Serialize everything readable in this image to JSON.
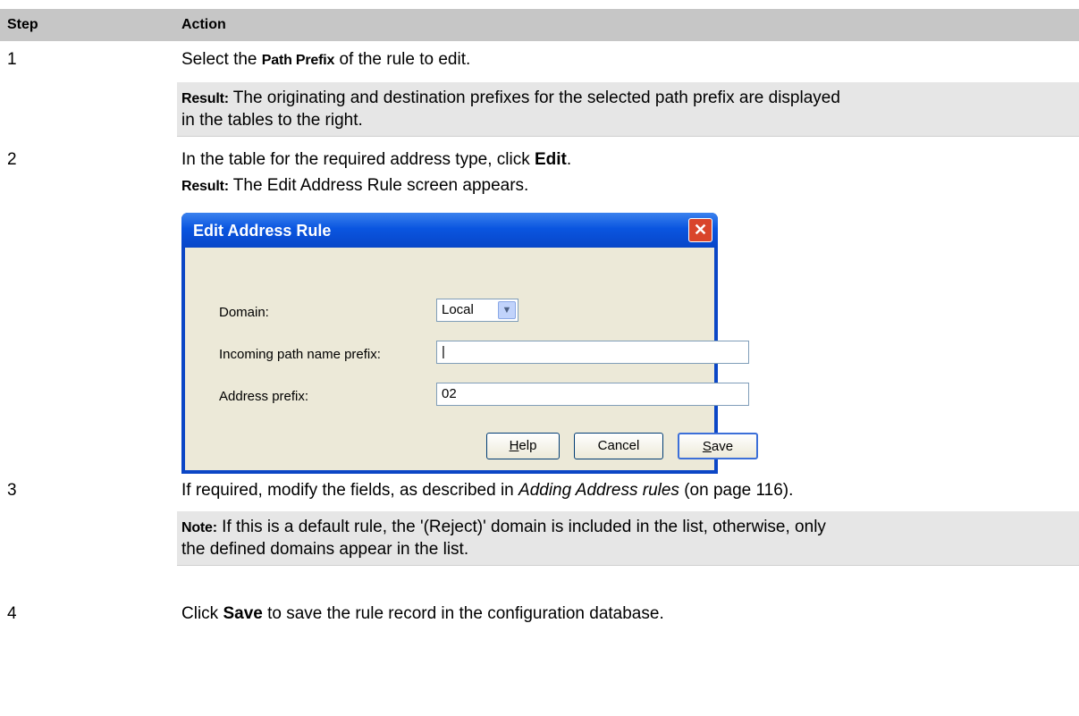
{
  "header": {
    "step": "Step",
    "action": "Action"
  },
  "steps": [
    {
      "num": "1",
      "text_before": "Select the ",
      "bold": "Path Prefix",
      "text_after": " of the rule to edit.",
      "result_label": "Result:",
      "result_text": "The originating and destination prefixes for the selected path prefix are displayed",
      "result_text2": "in the tables to the right."
    },
    {
      "num": "2",
      "text_before": "In the table for the required address type, click ",
      "bold": "Edit",
      "text_after": ".",
      "result_label": "Result:",
      "result_text": "The Edit Address Rule screen appears."
    },
    {
      "num": "3",
      "text_before": "If required, modify the fields, as described in ",
      "italic": "Adding Address rules",
      "text_after": " (on page 116).",
      "note_label": "Note:",
      "note_text": "If this is a default rule, the '(Reject)' domain is included in the list, otherwise, only",
      "note_text2": "the defined domains appear in the list."
    },
    {
      "num": "4",
      "text_before": "Click ",
      "bold": "Save",
      "text_after": " to save the rule record in the configuration database."
    }
  ],
  "dialog": {
    "title": "Edit Address Rule",
    "domain_label": "Domain:",
    "domain_value": "Local",
    "incoming_label": "Incoming path name prefix:",
    "incoming_value": "|",
    "address_label": "Address prefix:",
    "address_value": "02",
    "help_first": "H",
    "help_rest": "elp",
    "cancel": "Cancel",
    "save_first": "S",
    "save_rest": "ave"
  },
  "colors": {
    "title_bar": "#0a55e0",
    "dialog_body": "#ece9d8",
    "close": "#d9452b",
    "header_bg": "#c6c6c6",
    "shade_bg": "#e6e6e6"
  }
}
